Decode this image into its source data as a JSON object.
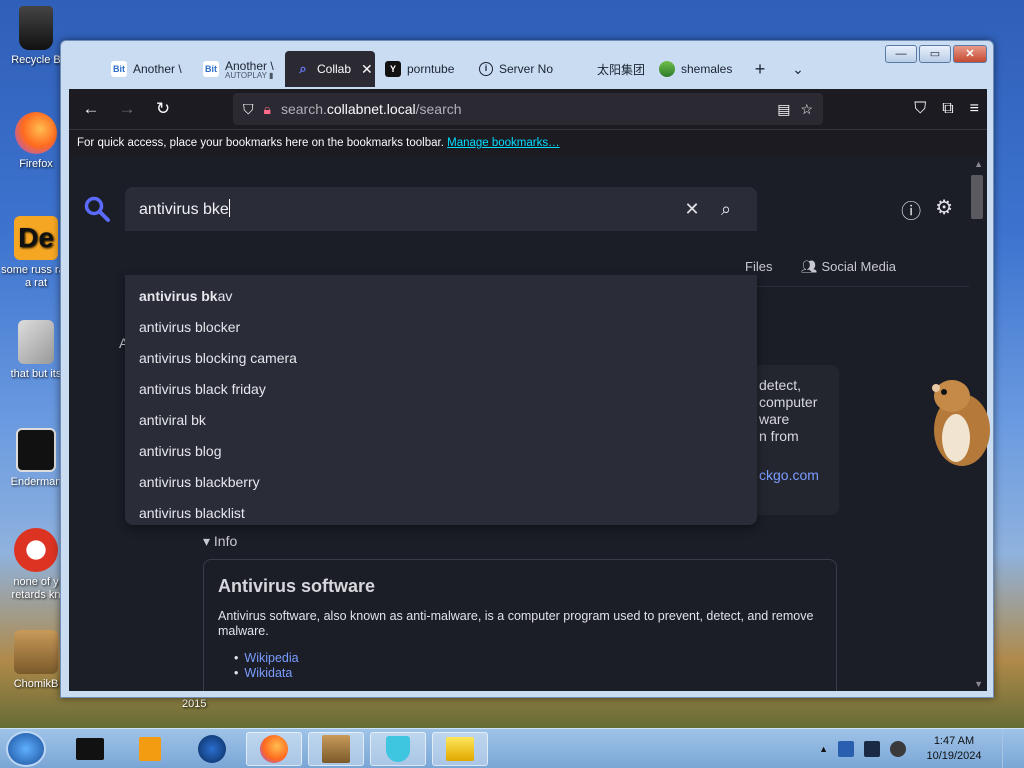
{
  "desktop": {
    "icons": [
      {
        "label": "Recycle B"
      },
      {
        "label": "Firefox"
      },
      {
        "label": "some russ ran a rat"
      },
      {
        "label": "that but its"
      },
      {
        "label": "Enderman"
      },
      {
        "label": "none of y retards kn"
      },
      {
        "label": "ChomikB"
      }
    ],
    "year_label": "2015"
  },
  "window": {
    "minimize": "—",
    "maximize": "▭",
    "close": "✕"
  },
  "tabs": [
    {
      "title": "Another \\",
      "favicon": "Bit"
    },
    {
      "title": "Another \\",
      "subtitle": "AUTOPLAY ▮",
      "favicon": "Bit"
    },
    {
      "title": "Collab",
      "active": true
    },
    {
      "title": "porntube",
      "favicon": "Y"
    },
    {
      "title": "Server No",
      "favicon": "i"
    },
    {
      "title": "太阳集团"
    },
    {
      "title": "shemales"
    }
  ],
  "tab_actions": {
    "new_tab": "+",
    "list_all": "⌄"
  },
  "toolbar": {
    "back": "←",
    "forward": "→",
    "reload": "↻",
    "url_prefix": "search.",
    "url_host": "collabnet.local",
    "url_path": "/search"
  },
  "bookmarks_bar": {
    "text": "For quick access, place your bookmarks here on the bookmarks toolbar.",
    "link": "Manage bookmarks…"
  },
  "search": {
    "query": "antivirus bke",
    "clear": "✕",
    "submit": "⌕"
  },
  "suggestions": [
    {
      "bold": "antivirus bk",
      "rest": "av"
    },
    {
      "bold": "",
      "rest": "antivirus blocker"
    },
    {
      "bold": "",
      "rest": "antivirus blocking camera"
    },
    {
      "bold": "",
      "rest": "antivirus black friday"
    },
    {
      "bold": "",
      "rest": "antiviral bk"
    },
    {
      "bold": "",
      "rest": "antivirus blog"
    },
    {
      "bold": "",
      "rest": "antivirus blackberry"
    },
    {
      "bold": "",
      "rest": "antivirus blacklist"
    }
  ],
  "category_tabs": {
    "files": "Files",
    "social": "Social Media"
  },
  "background_card": {
    "line1": "detect,",
    "line2": "computer",
    "line3": "ware",
    "line4": "n from",
    "link": "ckgo.com"
  },
  "left_fragment": "A",
  "info": {
    "toggle": "▾ Info",
    "title": "Antivirus software",
    "description": "Antivirus software, also known as anti-malware, is a computer program used to prevent, detect, and remove malware.",
    "links": [
      "Wikipedia",
      "Wikidata"
    ]
  },
  "taskbar": {
    "time": "1:47 AM",
    "date": "10/19/2024"
  },
  "colors": {
    "accent": "#5b6bff",
    "page_bg": "#1b1e27",
    "link": "#7a9cff"
  }
}
